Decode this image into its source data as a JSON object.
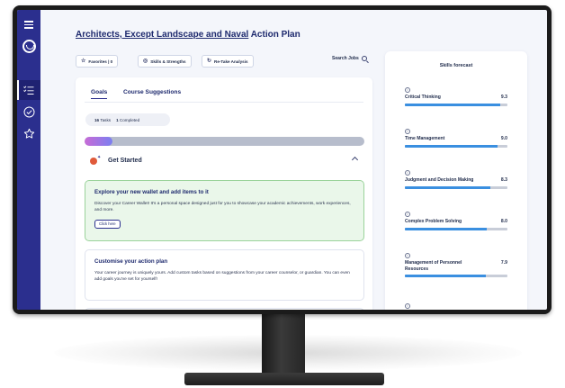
{
  "page": {
    "title_linked": "Architects, Except Landscape and Naval",
    "title_suffix": " Action Plan"
  },
  "toolbar": {
    "favorites_label": "Favorites | 0",
    "skills_label": "Skills & Strengths",
    "retake_label": "Re-Take Analysis",
    "search_jobs_label": "Search Jobs"
  },
  "goals": {
    "tabs": [
      {
        "label": "Goals",
        "active": true
      },
      {
        "label": "Course Suggestions",
        "active": false
      }
    ],
    "tasks_count": "16",
    "tasks_label": "Tasks",
    "completed_count": "1",
    "completed_label": "Completed",
    "progress_fraction": 0.1,
    "section_title": "Get Started",
    "items": [
      {
        "title": "Explore your new wallet and add items to it",
        "body": "Discover your Career Wallet! It's a personal space designed just for you to showcase your academic achievements, work experiences, and more.",
        "button": "Click here"
      },
      {
        "title": "Customise your action plan",
        "body": "Your career journey is uniquely yours. Add custom tasks based on suggestions from your career counselor, or guardian. You can even add goals you've set for yourself!"
      }
    ]
  },
  "skills": {
    "title": "Skills forecast",
    "info_glyph": "i",
    "items": [
      {
        "name": "Critical Thinking",
        "value": "9.3",
        "fraction": 0.93
      },
      {
        "name": "Time Management",
        "value": "9.0",
        "fraction": 0.9
      },
      {
        "name": "Judgment and Decision Making",
        "value": "8.3",
        "fraction": 0.83
      },
      {
        "name": "Complex Problem Solving",
        "value": "8.0",
        "fraction": 0.8
      },
      {
        "name": "Management of Personnel Resources",
        "value": "7.9",
        "fraction": 0.79
      }
    ]
  },
  "colors": {
    "sidebar": "#2b2f8e",
    "accent": "#2b2f8e",
    "skill_bar": "#3a8fe0",
    "task_highlight_bg": "#eaf7ea",
    "task_highlight_border": "#9bd39b"
  },
  "icons": {
    "sidebar": [
      "hamburger-icon",
      "logo-icon",
      "checklist-icon",
      "check-circle-icon",
      "star-icon"
    ],
    "favorites": "star-icon",
    "skills": "target-icon",
    "retake": "refresh-icon",
    "search": "search-icon",
    "get_started": "rocket-icon",
    "collapse": "chevron-up-icon"
  }
}
